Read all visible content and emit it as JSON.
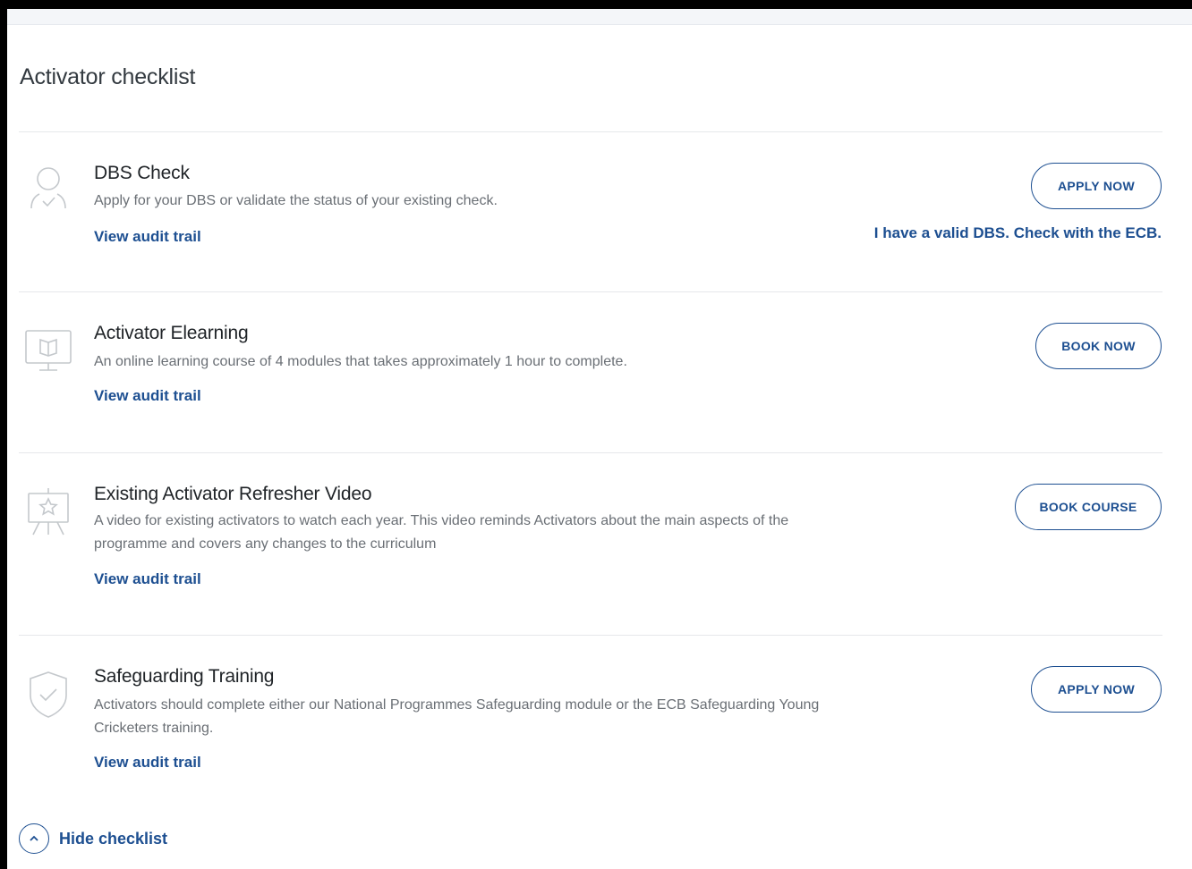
{
  "checklist": {
    "title": "Activator checklist",
    "hide_label": "Hide checklist",
    "items": [
      {
        "icon": "person-check-icon",
        "title": "DBS Check",
        "description": "Apply for your DBS or validate the status of your existing check.",
        "audit_link": "View audit trail",
        "button_label": "APPLY NOW",
        "secondary_link": "I have a valid DBS. Check with the ECB."
      },
      {
        "icon": "monitor-book-icon",
        "title": "Activator Elearning",
        "description": "An online learning course of 4 modules that takes approximately 1 hour to complete.",
        "audit_link": "View audit trail",
        "button_label": "BOOK NOW"
      },
      {
        "icon": "easel-star-icon",
        "title": "Existing Activator Refresher Video",
        "description": "A video for existing activators to watch each year. This video reminds Activators about the main aspects of the programme and covers any changes to the curriculum",
        "audit_link": "View audit trail",
        "button_label": "BOOK COURSE"
      },
      {
        "icon": "shield-check-icon",
        "title": "Safeguarding Training",
        "description": "Activators should complete either our National Programmes Safeguarding module or the ECB Safeguarding Young Cricketers training.",
        "audit_link": "View audit trail",
        "button_label": "APPLY NOW"
      }
    ]
  },
  "colors": {
    "accent": "#1d4f91",
    "text_dark": "#1f2327",
    "text_muted": "#6a6f75",
    "icon_grey": "#c4c8cc"
  }
}
